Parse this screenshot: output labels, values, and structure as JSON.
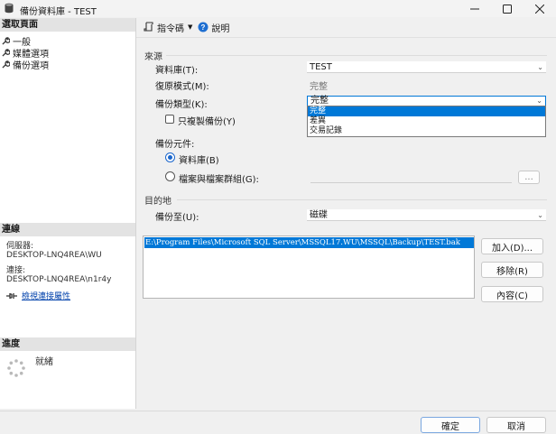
{
  "window": {
    "title": "備份資料庫 - TEST"
  },
  "left": {
    "select_page_header": "選取頁面",
    "pages": [
      "一般",
      "媒體選項",
      "備份選項"
    ],
    "connection_header": "連線",
    "server_label": "伺服器:",
    "server_value": "DESKTOP-LNQ4REA\\WU",
    "connection_label": "連接:",
    "connection_value": "DESKTOP-LNQ4REA\\n1r4y",
    "view_props_link": "檢視連接屬性",
    "progress_header": "進度",
    "progress_status": "就緒"
  },
  "toolbar": {
    "script_label": "指令碼",
    "help_label": "說明"
  },
  "form": {
    "source_title": "來源",
    "database_label": "資料庫(T):",
    "database_value": "TEST",
    "recovery_label": "復原模式(M):",
    "recovery_value": "完整",
    "backup_type_label": "備份類型(K):",
    "backup_type_value": "完整",
    "backup_type_options": [
      "完整",
      "差異",
      "交易記錄"
    ],
    "copy_only_label": "只複製備份(Y)",
    "component_label": "備份元件:",
    "database_radio": "資料庫(B)",
    "files_radio": "檔案與檔案群組(G):",
    "browse_label": "...",
    "destination_title": "目的地",
    "backup_to_label": "備份至(U):",
    "backup_to_value": "磁碟",
    "backup_files": [
      "E:\\Program Files\\Microsoft SQL Server\\MSSQL17.WU\\MSSQL\\Backup\\TEST.bak"
    ],
    "add_button": "加入(D)...",
    "remove_button": "移除(R)",
    "contents_button": "內容(C)"
  },
  "footer": {
    "ok_button": "確定",
    "cancel_button": "取消"
  }
}
